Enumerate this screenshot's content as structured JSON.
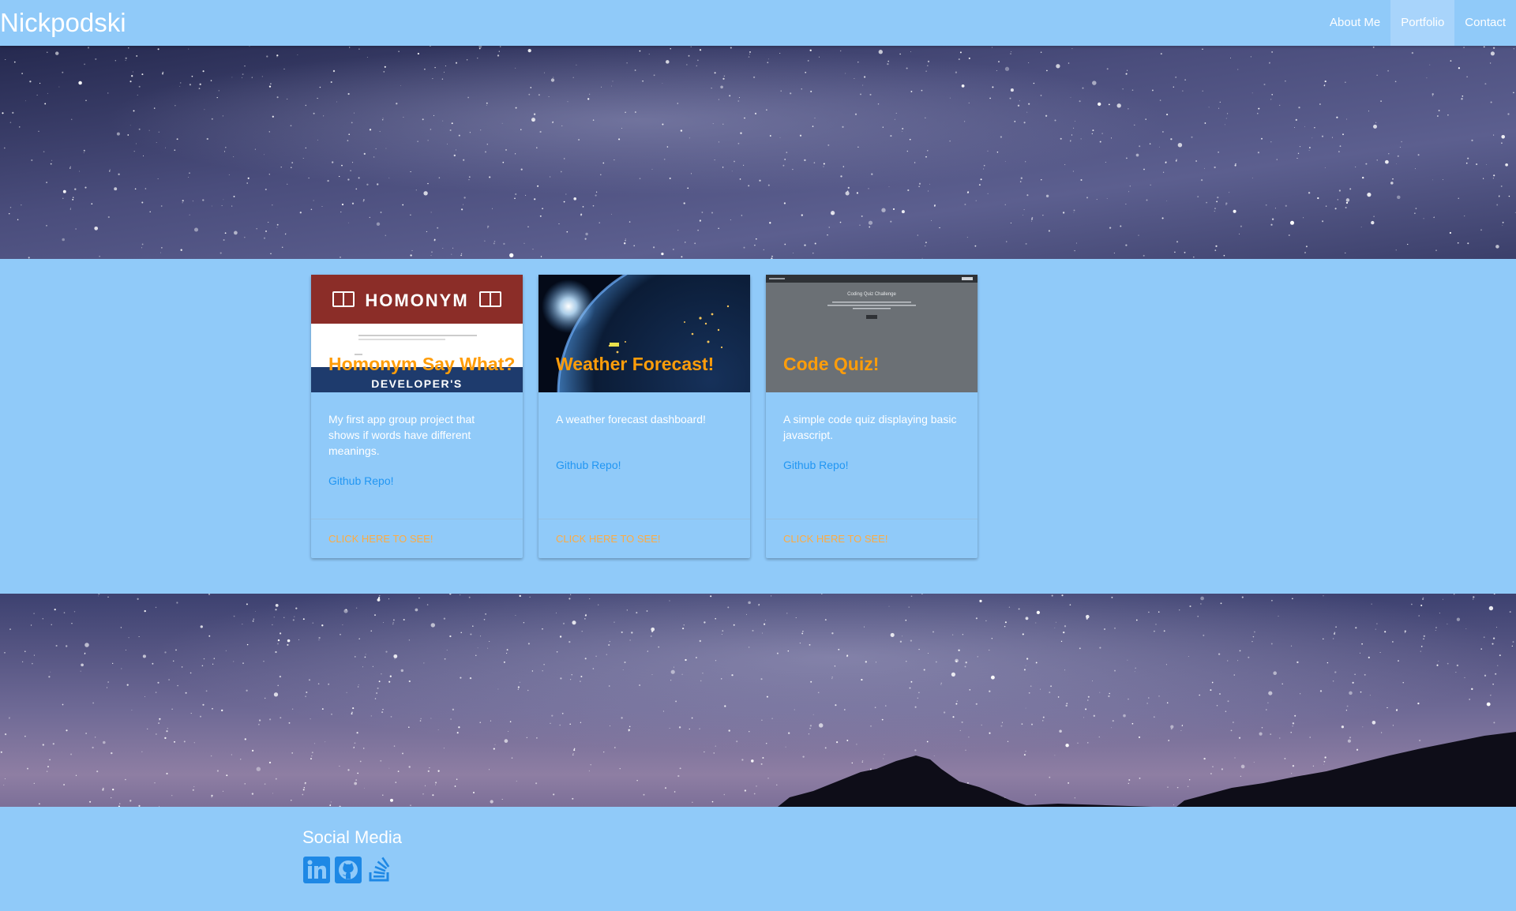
{
  "nav": {
    "brand": "Nickpodski",
    "links": [
      {
        "label": "About Me",
        "active": false
      },
      {
        "label": "Portfolio",
        "active": true
      },
      {
        "label": "Contact",
        "active": false
      }
    ]
  },
  "cards": [
    {
      "title": "Homonym Say What?",
      "image_banner": "HOMONYM",
      "image_sub": "DEVELOPER'S",
      "description": "My first app group project that shows if words have different meanings.",
      "link_label": "Github Repo!",
      "action_label": "Click here to see!"
    },
    {
      "title": "Weather Forecast!",
      "description": "A weather forecast dashboard!",
      "link_label": "Github Repo!",
      "action_label": "Click here to see!"
    },
    {
      "title": "Code Quiz!",
      "image_heading": "Coding Quiz Challenge",
      "description": "A simple code quiz displaying basic javascript.",
      "link_label": "Github Repo!",
      "action_label": "Click here to see!"
    }
  ],
  "footer": {
    "title": "Social Media",
    "icons": [
      "linkedin-icon",
      "github-icon",
      "stackoverflow-icon"
    ]
  },
  "colors": {
    "page_bg": "#90caf9",
    "active_nav": "#a8d4fb",
    "card_title": "#ff9d0a",
    "link": "#2196f3",
    "action": "#ffab40",
    "icon": "#1e88e5"
  }
}
